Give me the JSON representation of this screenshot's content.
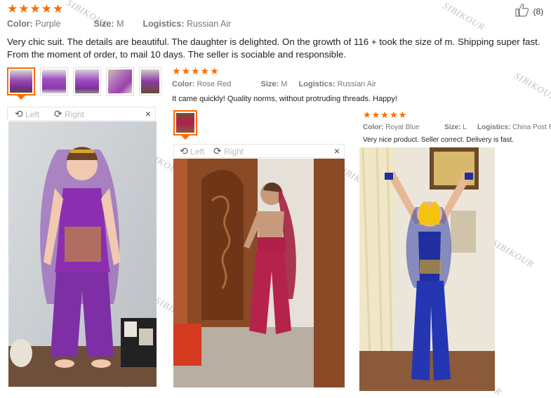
{
  "watermark": "SIBIKOUR",
  "helpful": {
    "icon": "thumbs-up-icon",
    "count": "(8)"
  },
  "viewer": {
    "left_label": "Left",
    "right_label": "Right",
    "close_label": "×",
    "left_icon": "rotate-left-icon",
    "right_icon": "rotate-right-icon"
  },
  "reviews": [
    {
      "stars": "★★★★★",
      "rating": 5,
      "color_label": "Color:",
      "color_value": "Purple",
      "size_label": "Size:",
      "size_value": "M",
      "logistics_label": "Logistics:",
      "logistics_value": "Russian Air",
      "text": "Very chic suit. The details are beautiful. The daughter is delighted. On the growth of 116 + took the size of m. Shipping super fast. From the moment of order, to mail 10 days. The seller is sociable and responsible."
    },
    {
      "stars": "★★★★★",
      "rating": 5,
      "color_label": "Color:",
      "color_value": "Rose Red",
      "size_label": "Size:",
      "size_value": "M",
      "logistics_label": "Logistics:",
      "logistics_value": "Russian Air",
      "text": "It came quickly! Quality norms, without protruding threads. Happy!"
    },
    {
      "stars": "★★★★★",
      "rating": 5,
      "color_label": "Color:",
      "color_value": "Royal Blue",
      "size_label": "Size:",
      "size_value": "L",
      "logistics_label": "Logistics:",
      "logistics_value": "China Post Regi:",
      "text": "Very nice product. Seller correct. Delivery is fast."
    }
  ],
  "colors": {
    "accent": "#ff6a00",
    "purple": "#7b2d9b",
    "rose": "#b0204a",
    "blue": "#1f2fa0"
  }
}
